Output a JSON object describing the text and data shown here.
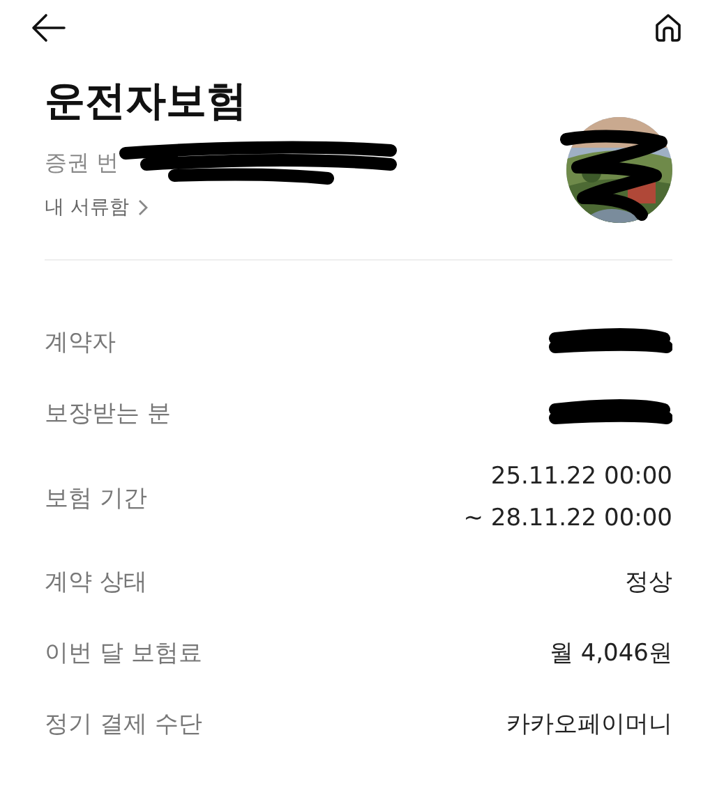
{
  "title": "운전자보험",
  "policy_number": {
    "label": "증권 번",
    "redacted": true
  },
  "documents_link": "내 서류함",
  "avatar": {
    "kind": "picture",
    "redacted": true
  },
  "details": [
    {
      "label": "계약자",
      "redacted": true
    },
    {
      "label": "보장받는 분",
      "redacted": true
    },
    {
      "label": "보험 기간",
      "redacted": false,
      "lines": [
        "25.11.22 00:00",
        "~ 28.11.22 00:00"
      ]
    },
    {
      "label": "계약 상태",
      "redacted": false,
      "lines": [
        "정상"
      ]
    },
    {
      "label": "이번 달 보험료",
      "redacted": false,
      "lines": [
        "월 4,046원"
      ]
    },
    {
      "label": "정기 결제 수단",
      "redacted": false,
      "lines": [
        "카카오페이머니"
      ]
    }
  ]
}
